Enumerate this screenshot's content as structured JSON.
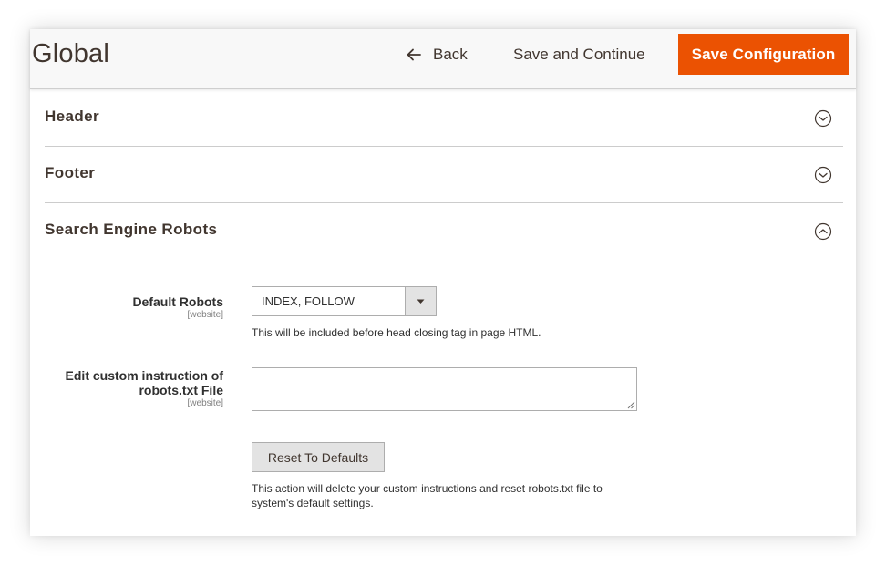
{
  "header": {
    "title": "Global",
    "back_label": "Back",
    "save_continue_label": "Save and Continue",
    "save_config_label": "Save Configuration",
    "accent_color": "#eb5202"
  },
  "sections": [
    {
      "title": "Header",
      "expanded": false,
      "toggle_icon": "chevron-down-icon"
    },
    {
      "title": "Footer",
      "expanded": false,
      "toggle_icon": "chevron-down-icon"
    },
    {
      "title": "Search Engine Robots",
      "expanded": true,
      "toggle_icon": "chevron-up-icon"
    }
  ],
  "robots": {
    "default_robots": {
      "label": "Default Robots",
      "scope": "[website]",
      "value": "INDEX, FOLLOW",
      "note": "This will be included before head closing tag in page HTML."
    },
    "custom_instruction": {
      "label_line1": "Edit custom instruction of",
      "label_line2": "robots.txt File",
      "scope": "[website]",
      "value": ""
    },
    "reset": {
      "button_label": "Reset To Defaults",
      "note_line1": "This action will delete your custom instructions and reset robots.txt file to",
      "note_line2": "system's default settings."
    }
  }
}
